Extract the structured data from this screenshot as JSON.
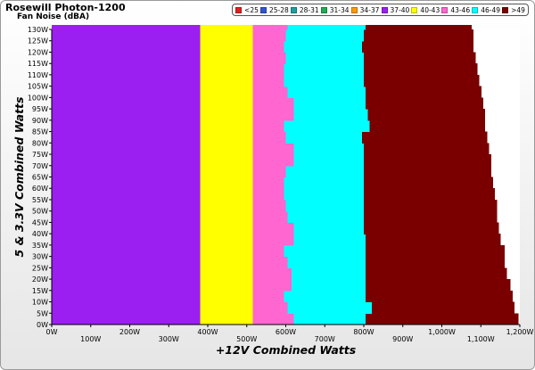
{
  "header": {
    "title": "Rosewill Photon-1200",
    "subtitle": "Fan Noise (dBA)"
  },
  "chart_data": {
    "type": "heatmap",
    "title": "Rosewill Photon-1200",
    "subtitle": "Fan Noise (dBA)",
    "xlabel": "+12V Combined Watts",
    "ylabel": "5 & 3.3V Combined Watts",
    "xlim": [
      0,
      1200
    ],
    "ylim": [
      0,
      130
    ],
    "x_ticks": [
      "0W",
      "100W",
      "200W",
      "300W",
      "400W",
      "500W",
      "600W",
      "700W",
      "800W",
      "900W",
      "1,000W",
      "1,100W",
      "1,200W"
    ],
    "y_ticks": [
      "0W",
      "5W",
      "10W",
      "15W",
      "20W",
      "25W",
      "30W",
      "35W",
      "40W",
      "45W",
      "50W",
      "55W",
      "60W",
      "65W",
      "70W",
      "75W",
      "80W",
      "85W",
      "90W",
      "95W",
      "100W",
      "105W",
      "110W",
      "115W",
      "120W",
      "125W",
      "130W"
    ],
    "legend_position": "top-right",
    "legend": [
      {
        "label": "<25",
        "color": "#e02020"
      },
      {
        "label": "25-28",
        "color": "#3355cc"
      },
      {
        "label": "28-31",
        "color": "#1f9e9e"
      },
      {
        "label": "31-34",
        "color": "#22aa55"
      },
      {
        "label": "34-37",
        "color": "#ff9900"
      },
      {
        "label": "37-40",
        "color": "#9a1ff0"
      },
      {
        "label": "40-43",
        "color": "#ffff00"
      },
      {
        "label": "43-46",
        "color": "#ff66d0"
      },
      {
        "label": "46-49",
        "color": "#00ffff"
      },
      {
        "label": ">49",
        "color": "#7a0000"
      }
    ],
    "band_colors": [
      "#9a1ff0",
      "#ffff00",
      "#ff66d0",
      "#00ffff",
      "#7a0000"
    ],
    "rows": [
      {
        "y": 0,
        "edges": [
          380,
          515,
          620,
          805,
          1195
        ]
      },
      {
        "y": 5,
        "edges": [
          380,
          515,
          605,
          820,
          1185
        ]
      },
      {
        "y": 10,
        "edges": [
          380,
          515,
          595,
          805,
          1180
        ]
      },
      {
        "y": 15,
        "edges": [
          380,
          515,
          615,
          805,
          1175
        ]
      },
      {
        "y": 20,
        "edges": [
          380,
          515,
          615,
          805,
          1165
        ]
      },
      {
        "y": 25,
        "edges": [
          380,
          515,
          605,
          805,
          1160
        ]
      },
      {
        "y": 30,
        "edges": [
          380,
          515,
          595,
          805,
          1160
        ]
      },
      {
        "y": 35,
        "edges": [
          380,
          515,
          620,
          805,
          1150
        ]
      },
      {
        "y": 40,
        "edges": [
          380,
          515,
          620,
          800,
          1145
        ]
      },
      {
        "y": 45,
        "edges": [
          380,
          515,
          605,
          800,
          1140
        ]
      },
      {
        "y": 50,
        "edges": [
          380,
          515,
          600,
          800,
          1140
        ]
      },
      {
        "y": 55,
        "edges": [
          380,
          515,
          595,
          800,
          1135
        ]
      },
      {
        "y": 60,
        "edges": [
          380,
          515,
          595,
          800,
          1130
        ]
      },
      {
        "y": 65,
        "edges": [
          380,
          515,
          600,
          800,
          1125
        ]
      },
      {
        "y": 70,
        "edges": [
          380,
          515,
          620,
          800,
          1125
        ]
      },
      {
        "y": 75,
        "edges": [
          380,
          515,
          620,
          800,
          1120
        ]
      },
      {
        "y": 80,
        "edges": [
          380,
          515,
          600,
          795,
          1115
        ]
      },
      {
        "y": 85,
        "edges": [
          380,
          515,
          595,
          815,
          1110
        ]
      },
      {
        "y": 90,
        "edges": [
          380,
          515,
          620,
          810,
          1110
        ]
      },
      {
        "y": 95,
        "edges": [
          380,
          515,
          620,
          805,
          1105
        ]
      },
      {
        "y": 100,
        "edges": [
          380,
          515,
          605,
          805,
          1100
        ]
      },
      {
        "y": 105,
        "edges": [
          380,
          515,
          595,
          800,
          1095
        ]
      },
      {
        "y": 110,
        "edges": [
          380,
          515,
          595,
          800,
          1090
        ]
      },
      {
        "y": 115,
        "edges": [
          380,
          515,
          600,
          800,
          1085
        ]
      },
      {
        "y": 120,
        "edges": [
          380,
          515,
          595,
          795,
          1080
        ]
      },
      {
        "y": 125,
        "edges": [
          380,
          515,
          600,
          800,
          1080
        ]
      },
      {
        "y": 130,
        "edges": [
          380,
          515,
          605,
          805,
          1075
        ]
      }
    ]
  }
}
